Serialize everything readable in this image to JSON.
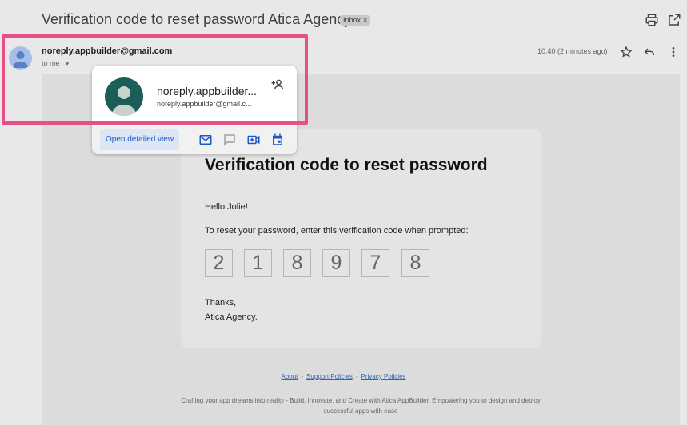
{
  "email": {
    "subject": "Verification code to reset password Atica Agency",
    "label": "Inbox",
    "label_close": "×",
    "sender": "noreply.appbuilder@gmail.com",
    "recipient": "to me",
    "time": "10:40 (2 minutes ago)"
  },
  "popup": {
    "name": "noreply.appbuilder...",
    "email": "noreply.appbuilder@gmail.c...",
    "open_detailed_label": "Open detailed view"
  },
  "body": {
    "title": "Verification code to reset password",
    "greeting": "Hello Jolie!",
    "instruction": "To reset your password, enter this verification code when prompted:",
    "code_digits": [
      "2",
      "1",
      "8",
      "9",
      "7",
      "8"
    ],
    "thanks": "Thanks,",
    "signoff": "Atica Agency."
  },
  "footer": {
    "links": [
      "About",
      "Support Policies",
      "Privacy Policies"
    ],
    "separator": "-",
    "tagline": "Crafting your app dreams into reality - Build, Innovate, and Create with Atica AppBuilder. Empowering you to design and deploy successful apps with ease"
  },
  "icons": {
    "print": "print-icon",
    "open_new_window": "open-in-new-window-icon",
    "star": "star-icon",
    "reply": "reply-icon",
    "more": "more-vert-icon",
    "dropdown": "chevron-down-icon",
    "add_contact": "add-contact-icon",
    "mail": "mail-icon",
    "chat": "chat-icon",
    "video": "video-call-icon",
    "calendar": "calendar-icon"
  },
  "colors": {
    "highlight": "#e84f8a",
    "link": "#3367b0",
    "accent": "#1a57c7"
  }
}
